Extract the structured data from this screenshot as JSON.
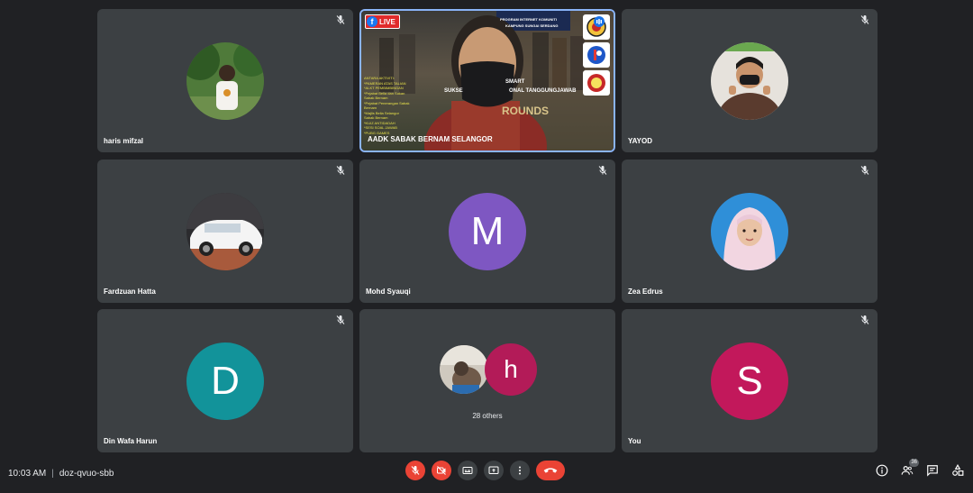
{
  "participants": [
    {
      "name": "haris mifzal",
      "muted": true,
      "avatar": "photo-boy-trees"
    },
    {
      "name": "AADK SABAK BERNAM SELANGOR",
      "live_badge": "LIVE",
      "video": true
    },
    {
      "name": "YAYOD",
      "muted": true,
      "avatar": "photo-masked-person"
    },
    {
      "name": "Fardzuan Hatta",
      "muted": true,
      "avatar": "photo-white-car"
    },
    {
      "name": "Mohd Syauqi",
      "muted": true,
      "avatar_letter": "M",
      "avatar_color": "#7e57c2"
    },
    {
      "name": "Zea Edrus",
      "muted": true,
      "avatar": "photo-hijab-girl"
    },
    {
      "name": "Din Wafa Harun",
      "muted": true,
      "avatar_letter": "D",
      "avatar_color": "#12939a"
    },
    {
      "others_label": "28 others",
      "avatar_letter": "h",
      "avatar_color": "#b31b58"
    },
    {
      "name": "You",
      "muted": true,
      "avatar_letter": "S",
      "avatar_color": "#c2185b"
    }
  ],
  "video_overlay": {
    "banner_top": "PROGRAM INTERNET KOMUNITI",
    "banner_sub": "KAMPUNG SUNGAI SERDANG",
    "text_left": "SUKSE",
    "text_right": "SMART",
    "text_right2": "ONAL TANGGUNGJAWAB",
    "game_text": "ROUNDS",
    "side_lines": [
      "ANTARA AKTIVITI:",
      "*PAMERAN ATAS TALIAN",
      "*ALKT PEMBIMBINGAN",
      "*Pejabat Belia dan Sukan",
      "Sabak Bernam",
      "*Pejabat Penerangan Sabak",
      "Bernam",
      "*Majlis Belia Selangor",
      "Sabak Bernam",
      "*KUIZ ANTIDADAH",
      "*SESI SOAL JAWAB",
      "*PUBG GAMES"
    ]
  },
  "bottom_bar": {
    "time": "10:03 AM",
    "separator": "|",
    "meeting_code": "doz-qvuo-sbb",
    "people_count": "36"
  },
  "colors": {
    "background": "#202124",
    "tile": "#3c4043",
    "hangup": "#ea4335",
    "active_border": "#8ab4f8"
  }
}
